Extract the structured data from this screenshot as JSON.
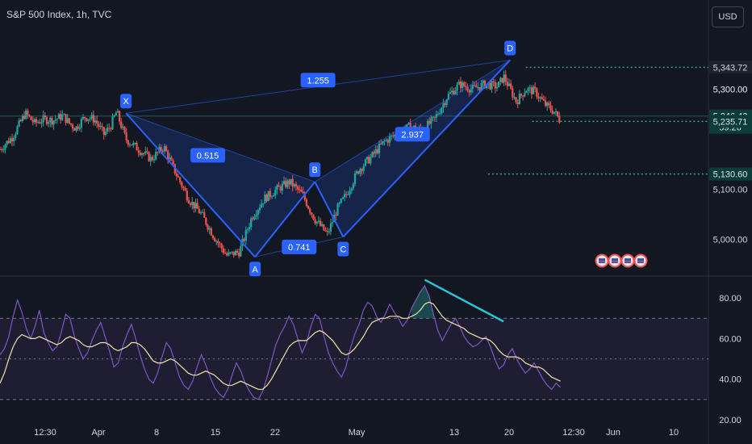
{
  "header": {
    "title": "S&P 500 Index, 1h, TVC",
    "currency_button": "USD"
  },
  "colors": {
    "background": "#131722",
    "up": "#26a69a",
    "down": "#ef5350",
    "harmonic": "#2962ff",
    "rsi": "#7e57c2",
    "rsi_ma": "#f3e5ab",
    "axis_text": "#d1d4dc"
  },
  "chart_data": [
    {
      "type": "candlestick",
      "title": "S&P 500 Index, 1h, TVC",
      "ylim": [
        4930,
        5470
      ],
      "y_ticks": [
        5000,
        5100,
        5300
      ],
      "y_tick_labels": [
        "5,000.00",
        "5,100.00",
        "5,300.00"
      ],
      "x_ticks": [
        "12:30",
        "Apr",
        "8",
        "15",
        "22",
        "May",
        "13",
        "20",
        "12:30",
        "Jun",
        "10"
      ],
      "price_path": [
        {
          "x": 0,
          "y": 5180
        },
        {
          "x": 4,
          "y": 5205
        },
        {
          "x": 8,
          "y": 5252
        },
        {
          "x": 11,
          "y": 5232
        },
        {
          "x": 14,
          "y": 5240
        },
        {
          "x": 17,
          "y": 5238
        },
        {
          "x": 20,
          "y": 5247
        },
        {
          "x": 22,
          "y": 5232
        },
        {
          "x": 24,
          "y": 5222
        },
        {
          "x": 27,
          "y": 5245
        },
        {
          "x": 30,
          "y": 5240
        },
        {
          "x": 33,
          "y": 5210
        },
        {
          "x": 35,
          "y": 5225
        },
        {
          "x": 37,
          "y": 5255
        },
        {
          "x": 40,
          "y": 5200
        },
        {
          "x": 44,
          "y": 5180
        },
        {
          "x": 48,
          "y": 5160
        },
        {
          "x": 52,
          "y": 5185
        },
        {
          "x": 56,
          "y": 5130
        },
        {
          "x": 60,
          "y": 5080
        },
        {
          "x": 64,
          "y": 5050
        },
        {
          "x": 68,
          "y": 5005
        },
        {
          "x": 72,
          "y": 4968
        },
        {
          "x": 76,
          "y": 4975
        },
        {
          "x": 80,
          "y": 5045
        },
        {
          "x": 84,
          "y": 5082
        },
        {
          "x": 88,
          "y": 5100
        },
        {
          "x": 92,
          "y": 5115
        },
        {
          "x": 96,
          "y": 5090
        },
        {
          "x": 100,
          "y": 5040
        },
        {
          "x": 104,
          "y": 5010
        },
        {
          "x": 107,
          "y": 5060
        },
        {
          "x": 110,
          "y": 5090
        },
        {
          "x": 114,
          "y": 5140
        },
        {
          "x": 118,
          "y": 5165
        },
        {
          "x": 122,
          "y": 5195
        },
        {
          "x": 126,
          "y": 5210
        },
        {
          "x": 130,
          "y": 5225
        },
        {
          "x": 134,
          "y": 5218
        },
        {
          "x": 138,
          "y": 5240
        },
        {
          "x": 142,
          "y": 5285
        },
        {
          "x": 146,
          "y": 5310
        },
        {
          "x": 150,
          "y": 5300
        },
        {
          "x": 154,
          "y": 5310
        },
        {
          "x": 158,
          "y": 5305
        },
        {
          "x": 160,
          "y": 5325
        },
        {
          "x": 162,
          "y": 5300
        },
        {
          "x": 164,
          "y": 5275
        },
        {
          "x": 167,
          "y": 5300
        },
        {
          "x": 170,
          "y": 5295
        },
        {
          "x": 173,
          "y": 5270
        },
        {
          "x": 176,
          "y": 5255
        },
        {
          "x": 178,
          "y": 5236
        }
      ],
      "x_range": [
        0,
        225
      ],
      "harmonic_points": [
        {
          "label": "X",
          "x": 40,
          "y": 5252
        },
        {
          "label": "A",
          "x": 81,
          "y": 4965
        },
        {
          "label": "B",
          "x": 100,
          "y": 5115
        },
        {
          "label": "C",
          "x": 109,
          "y": 5005
        },
        {
          "label": "D",
          "x": 162,
          "y": 5358
        }
      ],
      "harmonic_ratios": [
        {
          "label": "0.515",
          "x": 66,
          "y": 5168
        },
        {
          "label": "0.741",
          "x": 95,
          "y": 4985
        },
        {
          "label": "2.937",
          "x": 131,
          "y": 5210
        },
        {
          "label": "1.255",
          "x": 101,
          "y": 5318
        }
      ],
      "price_labels": [
        {
          "value": "5,343.72",
          "y": 5343.72,
          "bg": "#1e222d",
          "color": "#d1d4dc",
          "level_line": true,
          "line_x_start": 167
        },
        {
          "value": "5,300.00",
          "y": 5300,
          "bg": "none",
          "color": "#d1d4dc",
          "level_line": false
        },
        {
          "value": "5,246.43",
          "y": 5246.43,
          "bg": "#0b3d38",
          "color": "#e0e3eb",
          "level_line": false,
          "countdown": "59:26"
        },
        {
          "value": "5,235.71",
          "y": 5235.71,
          "bg": "#0b3d38",
          "color": "#e0e3eb",
          "level_line": true,
          "line_x_start": 169
        },
        {
          "value": "5,130.60",
          "y": 5130.6,
          "bg": "#0b3d38",
          "color": "#e0e3eb",
          "level_line": true,
          "line_x_start": 155
        }
      ],
      "event_icons": 4
    },
    {
      "type": "line",
      "title": "",
      "ylim": [
        20,
        90
      ],
      "y_ticks": [
        20,
        40,
        60,
        80
      ],
      "y_tick_labels": [
        "20.00",
        "40.00",
        "60.00",
        "80.00"
      ],
      "bands": [
        30,
        50,
        70
      ],
      "series": [
        {
          "values": [
            52,
            55,
            61,
            71,
            79,
            73,
            65,
            60,
            66,
            74,
            63,
            58,
            54,
            56,
            63,
            72,
            70,
            61,
            55,
            50,
            53,
            59,
            64,
            68,
            61,
            54,
            46,
            48,
            56,
            62,
            67,
            60,
            52,
            45,
            40,
            38,
            43,
            51,
            58,
            55,
            48,
            41,
            37,
            35,
            39,
            46,
            52,
            47,
            41,
            36,
            33,
            31,
            35,
            42,
            48,
            44,
            38,
            34,
            31,
            30,
            34,
            41,
            49,
            57,
            62,
            66,
            71,
            67,
            60,
            53,
            58,
            66,
            72,
            70,
            61,
            53,
            48,
            44,
            41,
            46,
            55,
            62,
            67,
            74,
            78,
            76,
            71,
            68,
            72,
            77,
            73,
            70,
            66,
            69,
            75,
            79,
            83,
            86,
            81,
            72,
            64,
            59,
            63,
            67,
            70,
            66,
            61,
            58,
            56,
            57,
            59,
            61,
            56,
            50,
            45,
            47,
            52,
            55,
            50,
            46,
            43,
            45,
            48,
            44,
            40,
            37,
            35,
            38,
            36
          ]
        },
        {
          "values": [
            38,
            43,
            50,
            56,
            60,
            62,
            61,
            60,
            60,
            61,
            60,
            59,
            58,
            57,
            58,
            60,
            61,
            60,
            59,
            57,
            56,
            56,
            57,
            58,
            58,
            57,
            55,
            54,
            55,
            56,
            58,
            58,
            57,
            55,
            52,
            49,
            48,
            48,
            49,
            50,
            49,
            47,
            45,
            43,
            42,
            42,
            43,
            44,
            43,
            42,
            40,
            38,
            37,
            37,
            38,
            39,
            38,
            37,
            36,
            35,
            35,
            37,
            40,
            44,
            48,
            52,
            56,
            58,
            59,
            59,
            59,
            61,
            63,
            64,
            63,
            61,
            59,
            56,
            53,
            52,
            53,
            55,
            58,
            61,
            65,
            68,
            69,
            70,
            70,
            71,
            71,
            71,
            70,
            70,
            71,
            72,
            74,
            77,
            78,
            77,
            74,
            71,
            69,
            68,
            67,
            66,
            65,
            63,
            62,
            61,
            60,
            60,
            59,
            57,
            54,
            52,
            51,
            51,
            51,
            50,
            48,
            47,
            46,
            46,
            45,
            43,
            41,
            40,
            39
          ]
        }
      ],
      "divergence_x": [
        107,
        115
      ],
      "divergence_y": [
        87,
        70
      ],
      "x_range": [
        0,
        225
      ]
    }
  ]
}
